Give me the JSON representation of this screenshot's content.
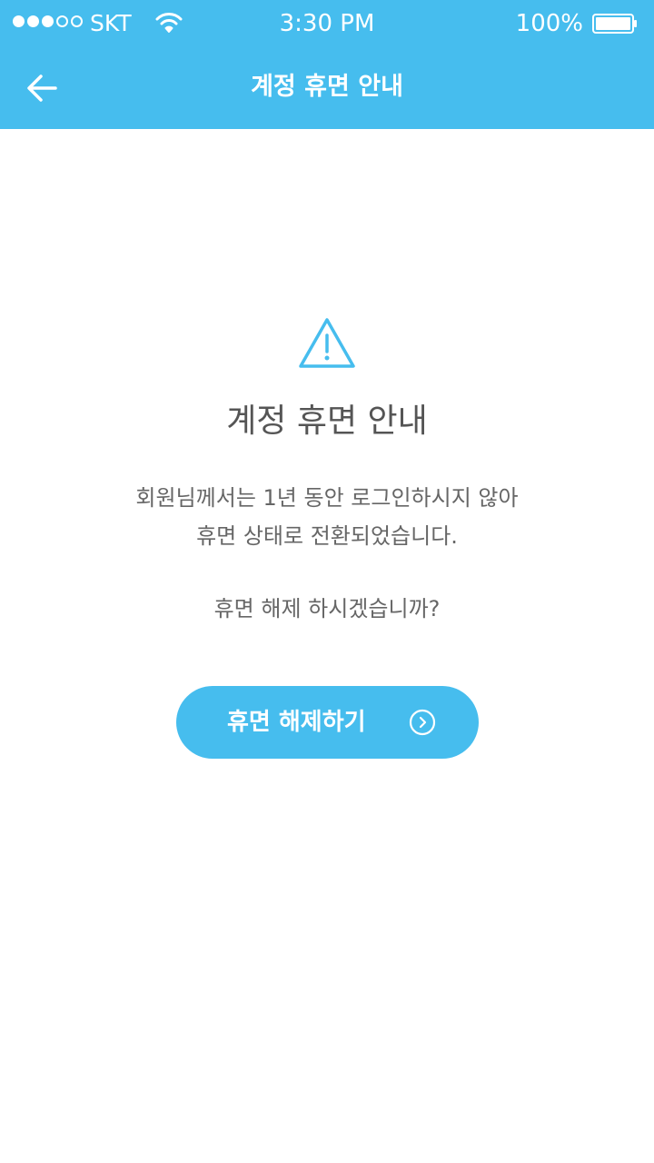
{
  "status_bar": {
    "carrier": "SKT",
    "time": "3:30 PM",
    "battery": "100%"
  },
  "nav": {
    "title": "계정 휴면 안내",
    "back_icon": "arrow-left-icon"
  },
  "main": {
    "icon": "warning-triangle-icon",
    "title": "계정 휴면 안내",
    "description_lines": [
      "회원님께서는 1년 동안 로그인하시지 않아",
      "휴면 상태로 전환되었습니다."
    ],
    "question": "휴면 해제 하시겠습니까?",
    "button_label": "휴면 해제하기",
    "button_icon": "chevron-right-circle-icon"
  },
  "colors": {
    "accent": "#46bdee",
    "text": "#555555",
    "background": "#ffffff"
  }
}
